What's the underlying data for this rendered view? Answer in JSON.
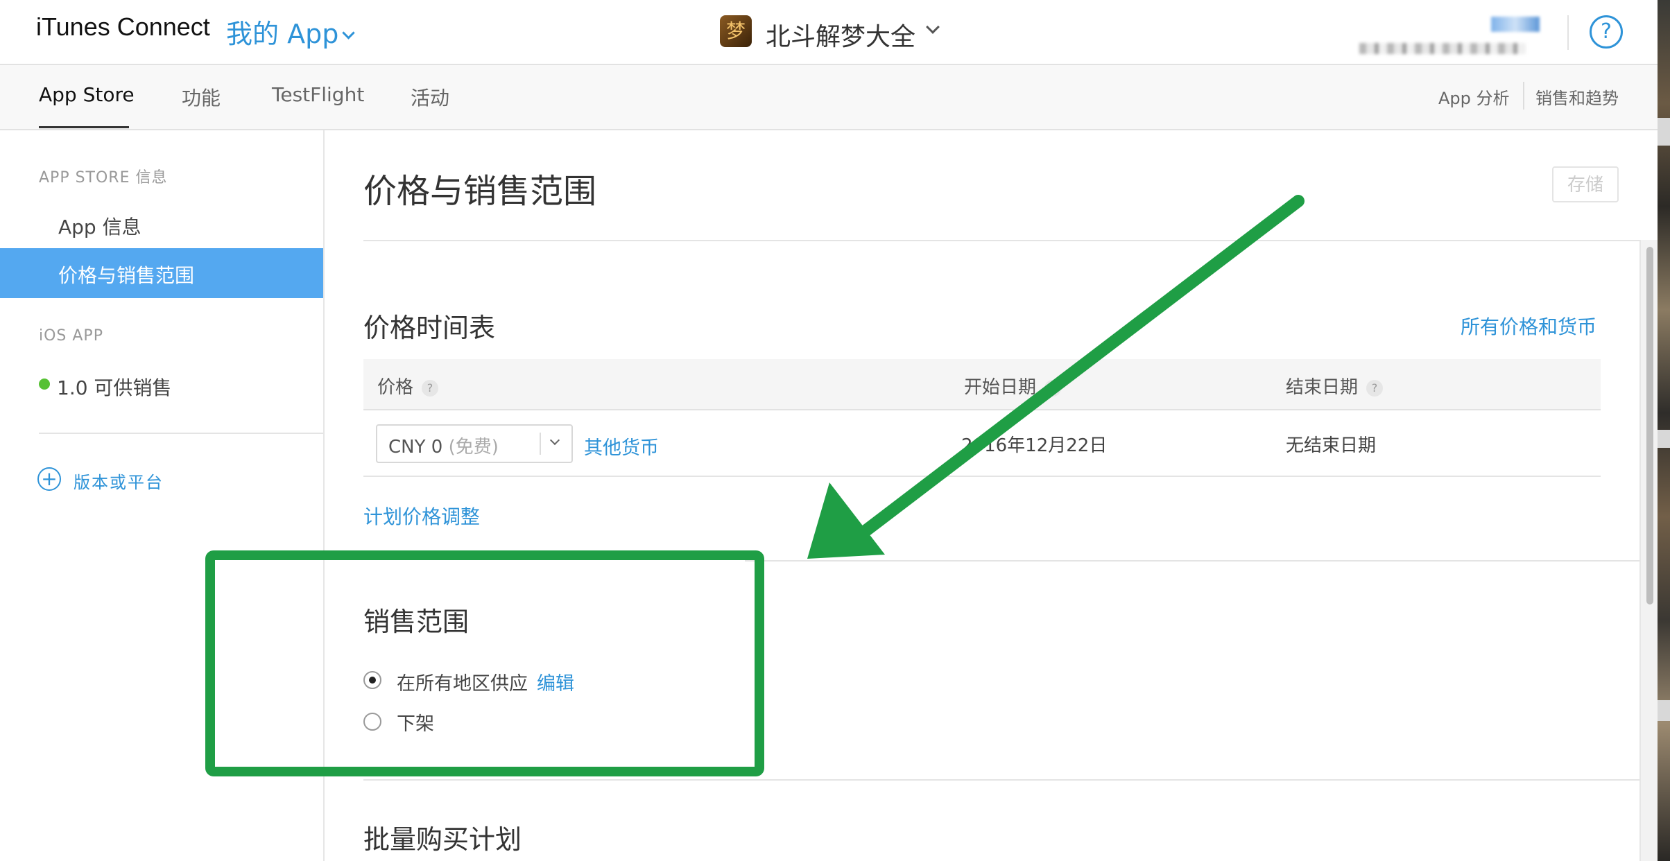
{
  "header": {
    "brand": "iTunes Connect",
    "my_app": "我的 App",
    "app_icon_glyph": "梦",
    "app_name": "北斗解梦大全",
    "help": "?"
  },
  "nav": {
    "tabs": [
      {
        "label": "App Store"
      },
      {
        "label": "功能"
      },
      {
        "label": "TestFlight"
      },
      {
        "label": "活动"
      }
    ],
    "right_links": [
      {
        "label": "App 分析"
      },
      {
        "label": "销售和趋势"
      }
    ]
  },
  "sidebar": {
    "section_store": "APP STORE 信息",
    "app_info": "App 信息",
    "pricing_active": "价格与销售范围",
    "section_ios": "iOS APP",
    "version": "1.0 可供销售",
    "version_status_color": "#56c134",
    "add_version": "版本或平台"
  },
  "main": {
    "title": "价格与销售范围",
    "save_label": "存储",
    "price_schedule": {
      "title": "价格时间表",
      "all_prices_link": "所有价格和货币",
      "columns": [
        "价格",
        "开始日期",
        "结束日期"
      ],
      "row": {
        "price_value": "CNY 0",
        "price_note": "(免费)",
        "other_currency": "其他货币",
        "start_date": "2016年12月22日",
        "end_date": "无结束日期"
      },
      "plan_adjust_link": "计划价格调整"
    },
    "availability": {
      "title": "销售范围",
      "options": [
        {
          "label": "在所有地区供应",
          "checked": true
        },
        {
          "label": "下架",
          "checked": false
        }
      ],
      "edit_link": "编辑"
    },
    "volume_purchase": {
      "title": "批量购买计划"
    }
  },
  "colors": {
    "accent": "#2e93d8",
    "sidebar_active": "#54a8f0",
    "annotation_green": "#1f9e45"
  }
}
